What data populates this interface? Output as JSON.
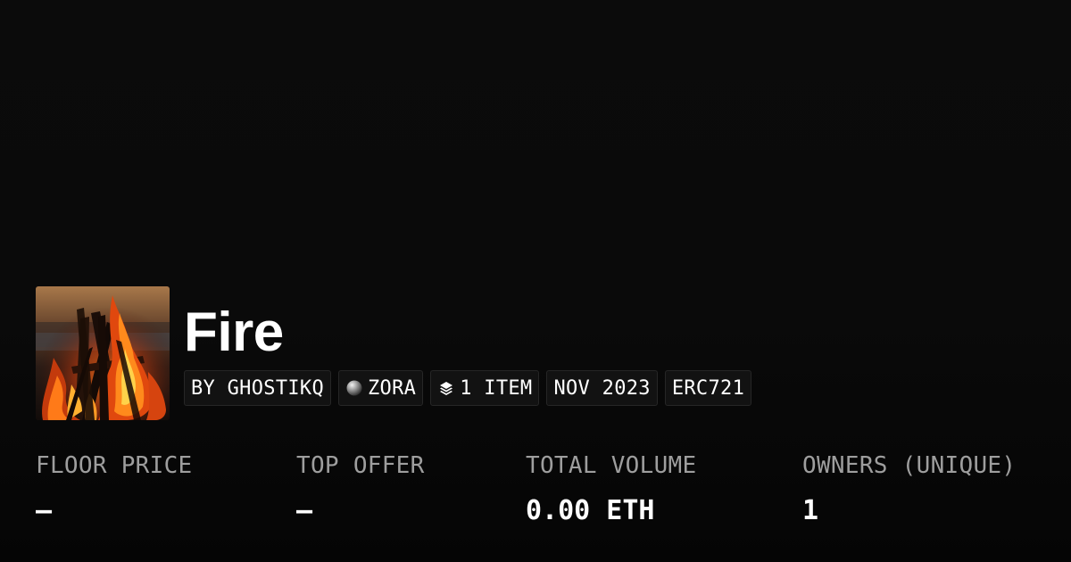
{
  "collection": {
    "name": "Fire",
    "thumbnail_icon": "bonfire-image"
  },
  "chips": {
    "creator": "BY GHOSTIKQ",
    "chain": "ZORA",
    "chain_icon": "zora-orb-icon",
    "items": "1 ITEM",
    "items_icon": "layers-icon",
    "date": "NOV 2023",
    "standard": "ERC721"
  },
  "stats": [
    {
      "label": "FLOOR PRICE",
      "value": "–"
    },
    {
      "label": "TOP OFFER",
      "value": "–"
    },
    {
      "label": "TOTAL VOLUME",
      "value": "0.00 ETH"
    },
    {
      "label": "OWNERS (UNIQUE)",
      "value": "1"
    }
  ],
  "colors": {
    "background": "#0a0a0a",
    "text": "#ffffff",
    "muted_label": "#9e9e9e",
    "chip_background": "#121212",
    "chip_border": "#262626"
  }
}
